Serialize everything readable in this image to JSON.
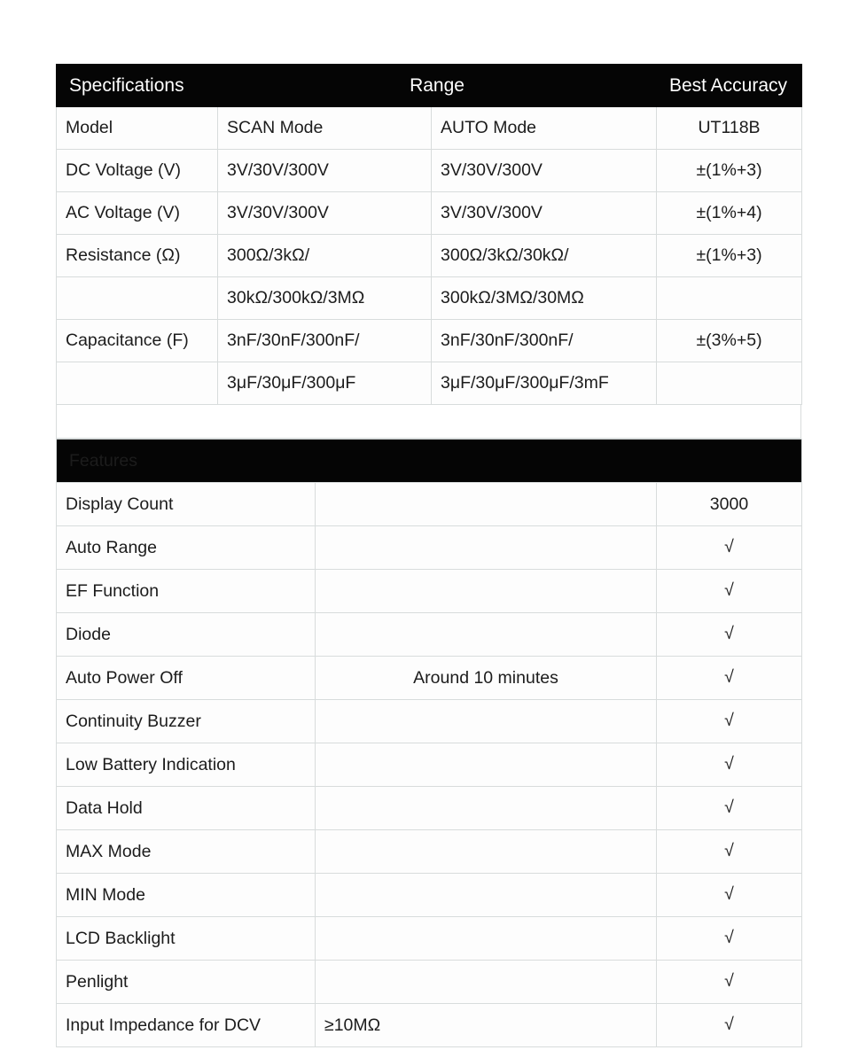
{
  "spec_table": {
    "header": {
      "specifications": "Specifications",
      "range": "Range",
      "best_accuracy": "Best Accuracy"
    },
    "rows": [
      {
        "label": "Model",
        "scan": "SCAN Mode",
        "auto": "AUTO Mode",
        "accuracy": "UT118B"
      },
      {
        "label": "DC Voltage (V)",
        "scan": "3V/30V/300V",
        "auto": "3V/30V/300V",
        "accuracy": "±(1%+3)"
      },
      {
        "label": "AC Voltage (V)",
        "scan": "3V/30V/300V",
        "auto": "3V/30V/300V",
        "accuracy": "±(1%+4)"
      },
      {
        "label": "Resistance (Ω)",
        "scan": "300Ω/3kΩ/",
        "auto": "300Ω/3kΩ/30kΩ/",
        "accuracy": "±(1%+3)"
      },
      {
        "label": "",
        "scan": "30kΩ/300kΩ/3MΩ",
        "auto": "300kΩ/3MΩ/30MΩ",
        "accuracy": ""
      },
      {
        "label": "Capacitance (F)",
        "scan": "3nF/30nF/300nF/",
        "auto": "3nF/30nF/300nF/",
        "accuracy": "±(3%+5)"
      },
      {
        "label": "",
        "scan": "3μF/30μF/300μF",
        "auto": "3μF/30μF/300μF/3mF",
        "accuracy": ""
      }
    ]
  },
  "features_table": {
    "header": {
      "features": "Features"
    },
    "rows": [
      {
        "name": "Display Count",
        "middle": "",
        "value": "3000"
      },
      {
        "name": "Auto Range",
        "middle": "",
        "value": "√"
      },
      {
        "name": "EF Function",
        "middle": "",
        "value": "√"
      },
      {
        "name": "Diode",
        "middle": "",
        "value": "√"
      },
      {
        "name": "Auto Power Off",
        "middle": "Around 10 minutes",
        "value": "√"
      },
      {
        "name": "Continuity Buzzer",
        "middle": "",
        "value": "√"
      },
      {
        "name": "Low Battery Indication",
        "middle": "",
        "value": "√"
      },
      {
        "name": "Data Hold",
        "middle": "",
        "value": "√"
      },
      {
        "name": "MAX Mode",
        "middle": "",
        "value": "√"
      },
      {
        "name": "MIN Mode",
        "middle": "",
        "value": "√"
      },
      {
        "name": "LCD Backlight",
        "middle": "",
        "value": "√"
      },
      {
        "name": "Penlight",
        "middle": "",
        "value": "√"
      },
      {
        "name": "Input Impedance for DCV",
        "middle": "≥10MΩ",
        "value": "√"
      }
    ]
  },
  "colors": {
    "banner_background": "#050505",
    "banner_text": "#ffffff",
    "grid_line": "#d8dcdc",
    "page_background": "#ffffff",
    "body_text": "#1c1c1c"
  }
}
